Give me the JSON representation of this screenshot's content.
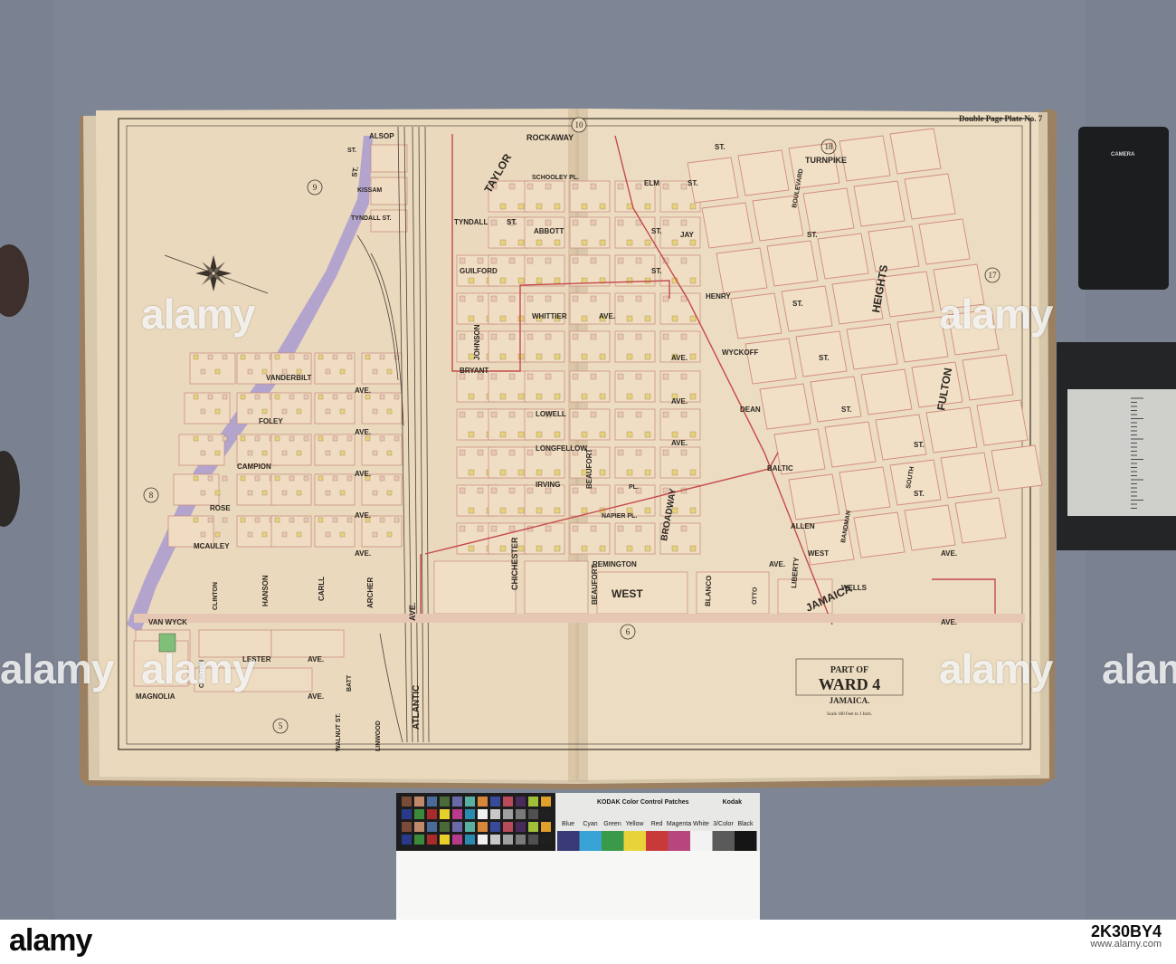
{
  "plate": {
    "title": "Double Page Plate No. 7",
    "cartouche_line1": "PART OF",
    "cartouche_line2": "WARD 4",
    "cartouche_line3": "JAMAICA.",
    "scale": "Scale 100 Feet to 1 Inch.",
    "adjoining_plates": [
      "10",
      "9",
      "18",
      "17",
      "8",
      "5",
      "6"
    ]
  },
  "streets": {
    "alsop": "ALSOP",
    "st": "ST.",
    "rockaway": "ROCKAWAY",
    "turnpike": "TURNPIKE",
    "kissam": "KISSAM",
    "tyndall_st": "TYNDALL ST.",
    "tyndall": "TYNDALL",
    "schooley": "SCHOOLEY PL.",
    "elm": "ELM",
    "jay": "JAY",
    "abbott": "ABBOTT",
    "guilford": "GUILFORD",
    "henry": "HENRY",
    "whittier": "WHITTIER",
    "wyckoff": "WYCKOFF",
    "bryant": "BRYANT",
    "vanderbilt": "VANDERBILT",
    "lowell": "LOWELL",
    "dean": "DEAN",
    "foley": "FOLEY",
    "longfellow": "LONGFELLOW",
    "baltic": "BALTIC",
    "campion": "CAMPION",
    "irving": "IRVING",
    "allen": "ALLEN",
    "rose": "ROSE",
    "napier": "NAPIER PL.",
    "west": "WEST",
    "mcauley": "MCAULEY",
    "remington": "REMINGTON",
    "wells": "WELLS",
    "van_wyck": "VAN WYCK",
    "lester": "LESTER",
    "magnolia": "MAGNOLIA",
    "ave": "AVE.",
    "pl": "PL.",
    "atlantic": "ATLANTIC",
    "broadway": "BROADWAY",
    "chichester": "CHICHESTER",
    "beaufort": "BEAUFORT",
    "johnson": "JOHNSON",
    "clinton": "CLINTON",
    "hanson": "HANSON",
    "carll": "CARLL",
    "archer": "ARCHER",
    "liberty": "LIBERTY",
    "blanco": "BLANCO",
    "otto": "OTTO",
    "bandman": "BANDMAN",
    "south": "SOUTH",
    "walnut": "WALNUT ST.",
    "linwood": "LINWOOD",
    "lott": "LOTT",
    "boulevard": "BOULEVARD",
    "fulton": "FULTON",
    "heights": "HEIGHTS",
    "batt": "BATT",
    "taylor": "TAYLOR",
    "west_label": "WEST",
    "jamaica": "JAMAICA"
  },
  "kodak": {
    "title": "KODAK Color Control Patches",
    "brand": "Kodak",
    "colors": [
      "Blue",
      "Cyan",
      "Green",
      "Yellow",
      "Red",
      "Magenta",
      "White",
      "3/Color",
      "Black"
    ],
    "patch_colors": [
      "#3a3a78",
      "#3aa3d6",
      "#3a9a4a",
      "#e8d43a",
      "#c83a3a",
      "#b8467e",
      "#f2f2f2",
      "#5a5a5a",
      "#151515"
    ],
    "card_label": "CAMERA"
  },
  "watermark": {
    "brand": "alamy",
    "stock_line1": "Image ID: 2K30BY4",
    "stock_line2": "www.alamy.com",
    "id_label": "2K30BY4"
  }
}
